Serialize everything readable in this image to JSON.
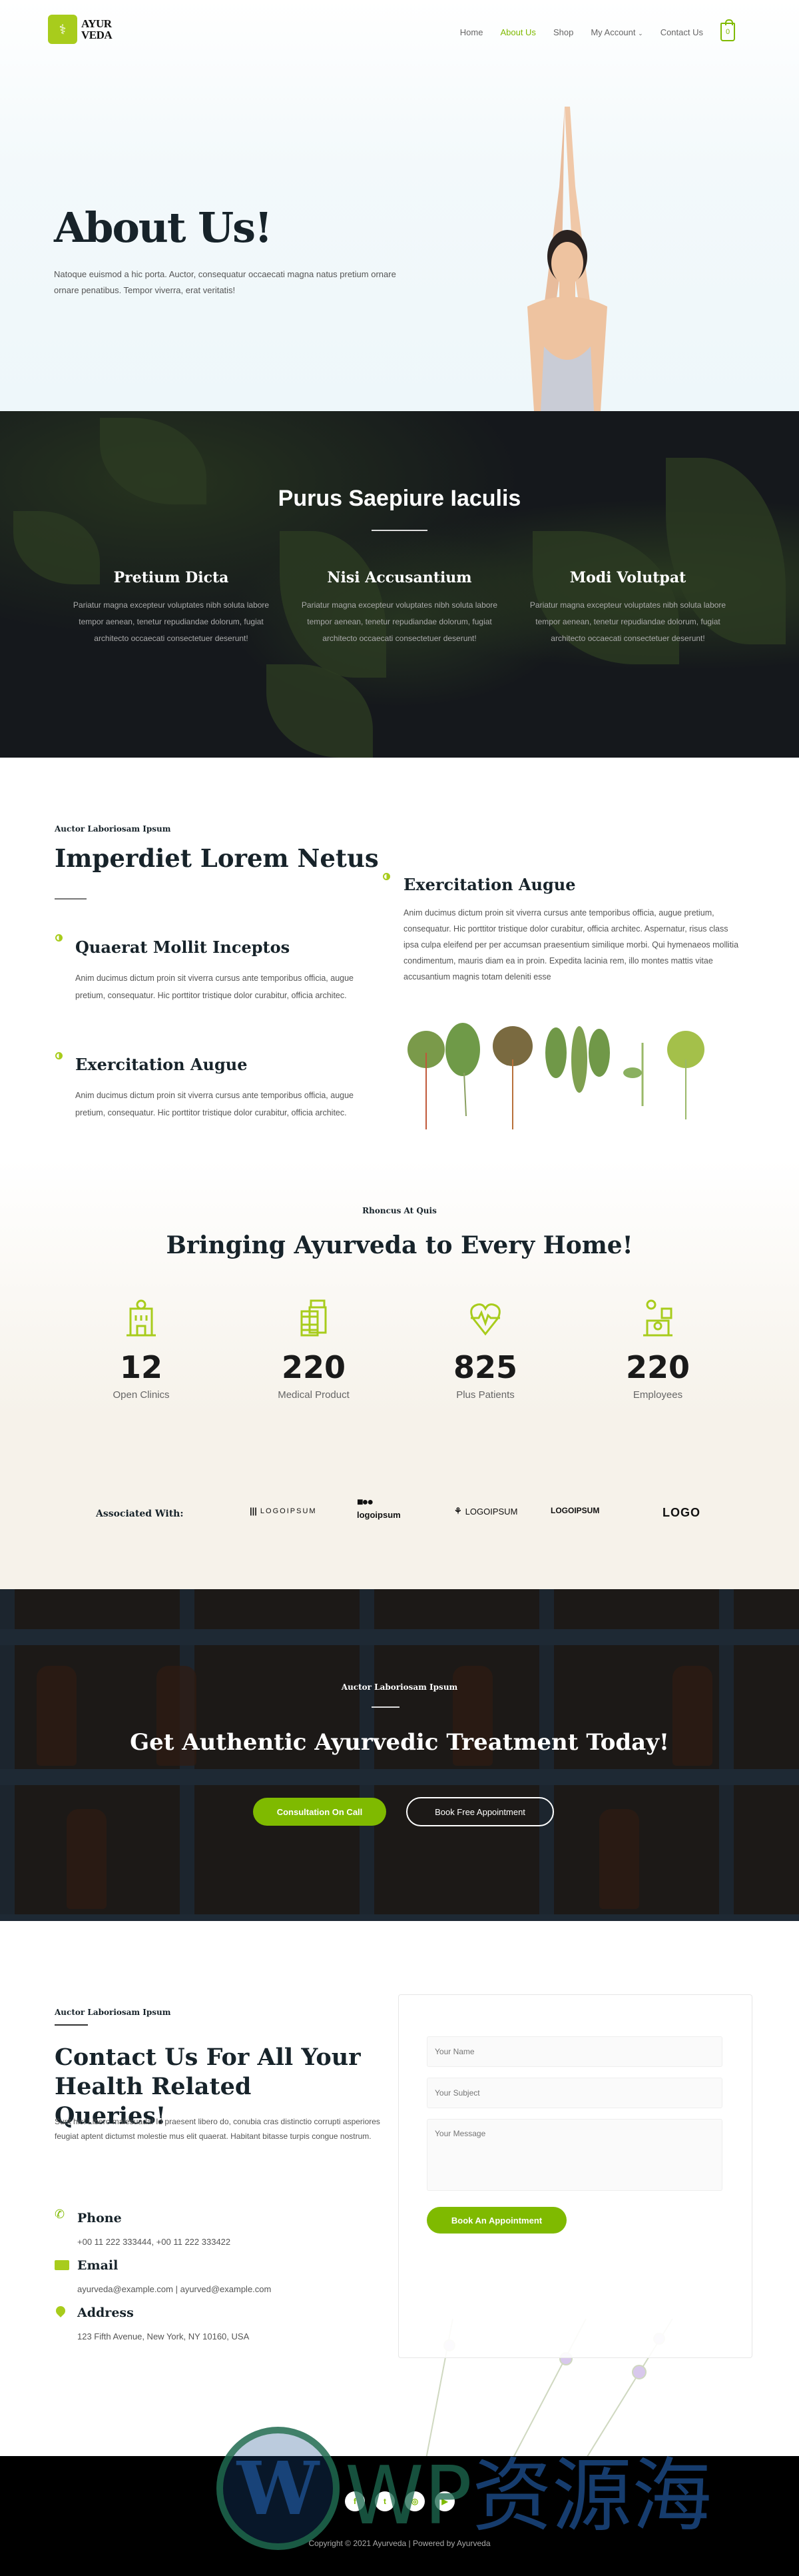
{
  "header": {
    "logo_line1": "AYUR",
    "logo_line2": "VEDA",
    "nav": [
      "Home",
      "About Us",
      "Shop",
      "My Account",
      "Contact Us"
    ],
    "active": "About Us",
    "cart_count": "0"
  },
  "hero": {
    "title": "About Us!",
    "text": "Natoque euismod a hic porta. Auctor, consequatur occaecati magna natus pretium ornare ornare penatibus. Tempor viverra, erat veritatis!"
  },
  "herbs": {
    "title": "Purus Saepiure Iaculis",
    "columns": [
      {
        "title": "Pretium Dicta",
        "text": "Pariatur magna excepteur voluptates nibh soluta labore tempor aenean, tenetur repudiandae dolorum, fugiat architecto occaecati consectetuer deserunt!"
      },
      {
        "title": "Nisi Accusantium",
        "text": "Pariatur magna excepteur voluptates nibh soluta labore tempor aenean, tenetur repudiandae dolorum, fugiat architecto occaecati consectetuer deserunt!"
      },
      {
        "title": "Modi Volutpat",
        "text": "Pariatur magna excepteur voluptates nibh soluta labore tempor aenean, tenetur repudiandae dolorum, fugiat architecto occaecati consectetuer deserunt!"
      }
    ]
  },
  "features": {
    "eyebrow": "Auctor Laboriosam Ipsum",
    "title": "Imperdiet Lorem Netus",
    "items": [
      {
        "title": "Quaerat Mollit Inceptos",
        "text": "Anim ducimus dictum proin sit viverra cursus ante temporibus officia, augue pretium, consequatur. Hic porttitor tristique dolor curabitur, officia architec."
      },
      {
        "title": "Exercitation Augue",
        "text": "Anim ducimus dictum proin sit viverra cursus ante temporibus officia, augue pretium, consequatur. Hic porttitor tristique dolor curabitur, officia architec."
      },
      {
        "title": "Exercitation Augue",
        "text": "Anim ducimus dictum proin sit viverra cursus ante temporibus officia, augue pretium, consequatur. Hic porttitor tristique dolor curabitur, officia architec. Aspernatur, risus class ipsa culpa eleifend per per accumsan praesentium similique morbi. Qui hymenaeos mollitia condimentum, mauris diam ea in proin. Expedita lacinia rem, illo montes mattis vitae accusantium magnis totam deleniti esse"
      }
    ]
  },
  "stats": {
    "eyebrow": "Rhoncus At Quis",
    "title": "Bringing Ayurveda to Every Home!",
    "items": [
      {
        "value": "12",
        "label": "Open Clinics",
        "icon": "clinic-icon"
      },
      {
        "value": "220",
        "label": "Medical Product",
        "icon": "medicine-icon"
      },
      {
        "value": "825",
        "label": "Plus Patients",
        "icon": "heartbeat-icon"
      },
      {
        "value": "220",
        "label": "Employees",
        "icon": "doctor-icon"
      }
    ],
    "associated_label": "Associated With:",
    "partners": [
      "LOGOIPSUM",
      "logoipsum",
      "LOGOIPSUM",
      "LOGOIPSUM",
      "LOGO"
    ]
  },
  "cta": {
    "eyebrow": "Auctor Laboriosam Ipsum",
    "title": "Get Authentic Ayurvedic Treatment Today!",
    "primary": "Consultation On Call",
    "secondary": "Book Free Appointment"
  },
  "contact": {
    "eyebrow": "Auctor Laboriosam Ipsum",
    "title": "Contact Us For All Your Health Related Queries!",
    "text": "Sunt hic! Libero malesuada! Id praesent libero do, conubia cras distinctio corrupti asperiores feugiat aptent dictumst molestie mus elit quaerat. Habitant bitasse turpis congue nostrum.",
    "phone_label": "Phone",
    "phone": "+00 11 222 333444, +00 11 222 333422",
    "email_label": "Email",
    "email": "ayurveda@example.com | ayurved@example.com",
    "address_label": "Address",
    "address": "123 Fifth Avenue, New York, NY 10160, USA",
    "form": {
      "name_placeholder": "Your Name",
      "subject_placeholder": "Your Subject",
      "message_placeholder": "Your Message",
      "submit": "Book An Appointment"
    }
  },
  "footer": {
    "copyright": "Copyright © 2021 Ayurveda | Powered by Ayurveda",
    "social": [
      "facebook-icon",
      "twitter-icon",
      "instagram-icon",
      "youtube-icon"
    ]
  },
  "watermark": "WP资源海",
  "colors": {
    "accent": "#7fba00",
    "logo": "#a8cc1c",
    "dark": "#17232a"
  }
}
